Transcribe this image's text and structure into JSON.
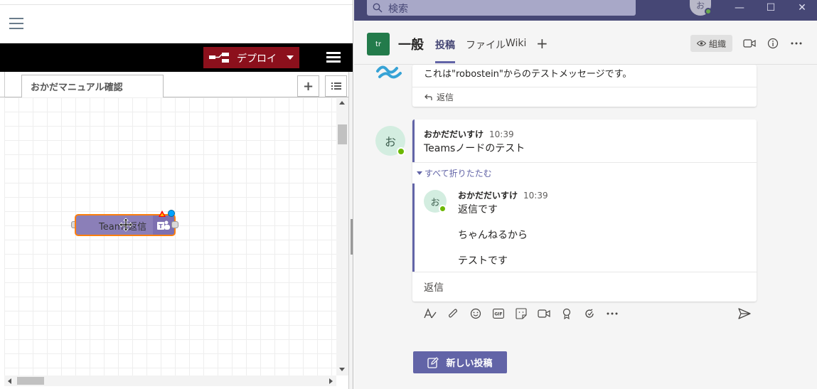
{
  "nodered": {
    "deploy_label": "デプロイ",
    "tab_label": "おかだマニュアル確認",
    "add_tab_label": "+",
    "node_label": "Teams返信",
    "accent_color": "#8c101c",
    "node_color": "#8b7fb8"
  },
  "teams": {
    "search_placeholder": "検索",
    "user_initial": "お",
    "team_tile": "tr",
    "channel_name": "一般",
    "tabs": {
      "posts": "投稿",
      "files": "ファイル",
      "wiki": "Wiki",
      "add": "+"
    },
    "org_label": "組織",
    "message1": {
      "text": "これは\"robostein\"からのテストメッセージです。",
      "reply_label": "返信"
    },
    "thread": {
      "avatar_initial": "お",
      "author": "おかだだいすけ",
      "time": "10:39",
      "body": "Teamsノードのテスト",
      "collapse_label": "すべて折りたたむ",
      "reply": {
        "avatar_initial": "お",
        "author": "おかだだいすけ",
        "time": "10:39",
        "lines": [
          "返信です",
          "ちゃんねるから",
          "テストです"
        ]
      },
      "reply_field": "返信"
    },
    "toolbar_icons": [
      "format-icon",
      "attach-icon",
      "emoji-icon",
      "gif-icon",
      "sticker-icon",
      "meet-now-icon",
      "praise-icon",
      "loop-icon",
      "more-options-icon"
    ],
    "new_post_label": "新しい投稿",
    "brand_color": "#6264a7",
    "titlebar_color": "#464775"
  }
}
